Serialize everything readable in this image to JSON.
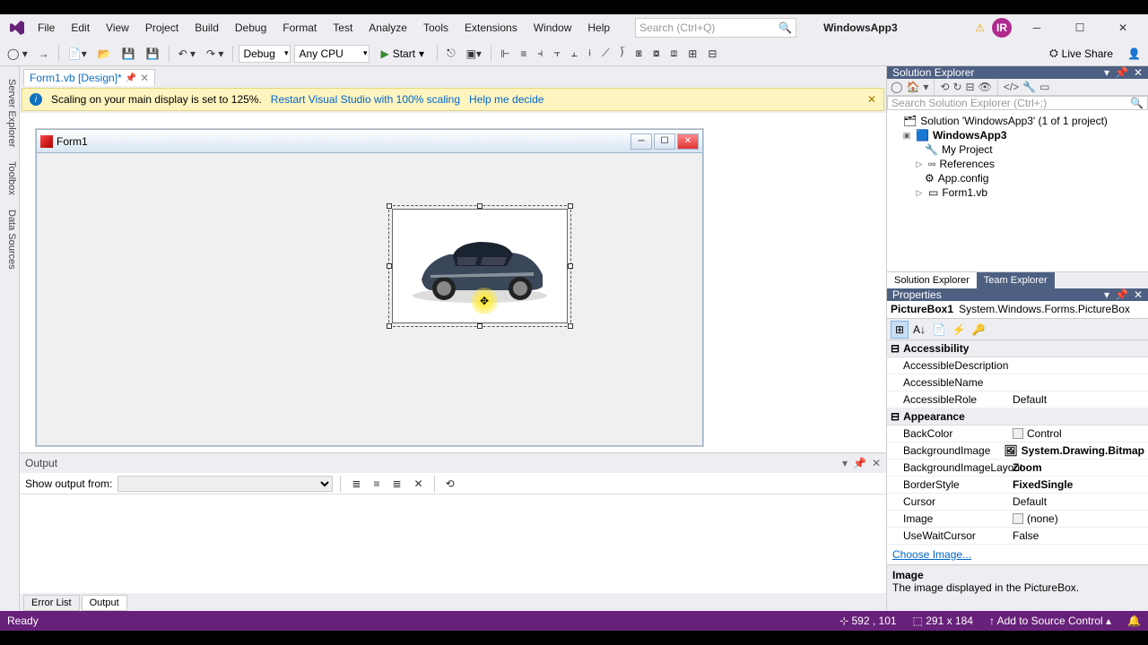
{
  "menu": [
    "File",
    "Edit",
    "View",
    "Project",
    "Build",
    "Debug",
    "Format",
    "Test",
    "Analyze",
    "Tools",
    "Extensions",
    "Window",
    "Help"
  ],
  "search_placeholder": "Search (Ctrl+Q)",
  "app_name": "WindowsApp3",
  "user_initials": "IR",
  "toolbar": {
    "config": "Debug",
    "platform": "Any CPU",
    "start": "Start",
    "liveshare": "Live Share"
  },
  "doc_tab": "Form1.vb [Design]*",
  "infobar": {
    "msg": "Scaling on your main display is set to 125%.",
    "link1": "Restart Visual Studio with 100% scaling",
    "link2": "Help me decide"
  },
  "form_title": "Form1",
  "side_tabs": [
    "Server Explorer",
    "Toolbox",
    "Data Sources"
  ],
  "output": {
    "title": "Output",
    "label": "Show output from:"
  },
  "bottom_tabs": [
    "Error List",
    "Output"
  ],
  "solution": {
    "title": "Solution Explorer",
    "search": "Search Solution Explorer (Ctrl+;)",
    "root": "Solution 'WindowsApp3' (1 of 1 project)",
    "project": "WindowsApp3",
    "items": [
      "My Project",
      "References",
      "App.config",
      "Form1.vb"
    ],
    "tabs": [
      "Solution Explorer",
      "Team Explorer"
    ]
  },
  "properties": {
    "title": "Properties",
    "object": "PictureBox1",
    "type": "System.Windows.Forms.PictureBox",
    "cats": {
      "acc": "Accessibility",
      "app": "Appearance"
    },
    "rows": [
      {
        "n": "AccessibleDescription",
        "v": ""
      },
      {
        "n": "AccessibleName",
        "v": ""
      },
      {
        "n": "AccessibleRole",
        "v": "Default"
      },
      {
        "n": "BackColor",
        "v": "Control",
        "sw": true
      },
      {
        "n": "BackgroundImage",
        "v": "System.Drawing.Bitmap",
        "b": true,
        "img": true
      },
      {
        "n": "BackgroundImageLayout",
        "v": "Zoom",
        "b": true
      },
      {
        "n": "BorderStyle",
        "v": "FixedSingle",
        "b": true
      },
      {
        "n": "Cursor",
        "v": "Default"
      },
      {
        "n": "Image",
        "v": "(none)",
        "sw": true
      },
      {
        "n": "UseWaitCursor",
        "v": "False"
      }
    ],
    "choose": "Choose Image...",
    "help_name": "Image",
    "help_desc": "The image displayed in the PictureBox."
  },
  "status": {
    "ready": "Ready",
    "pos": "592 , 101",
    "size": "291 x 184",
    "source": "Add to Source Control"
  }
}
